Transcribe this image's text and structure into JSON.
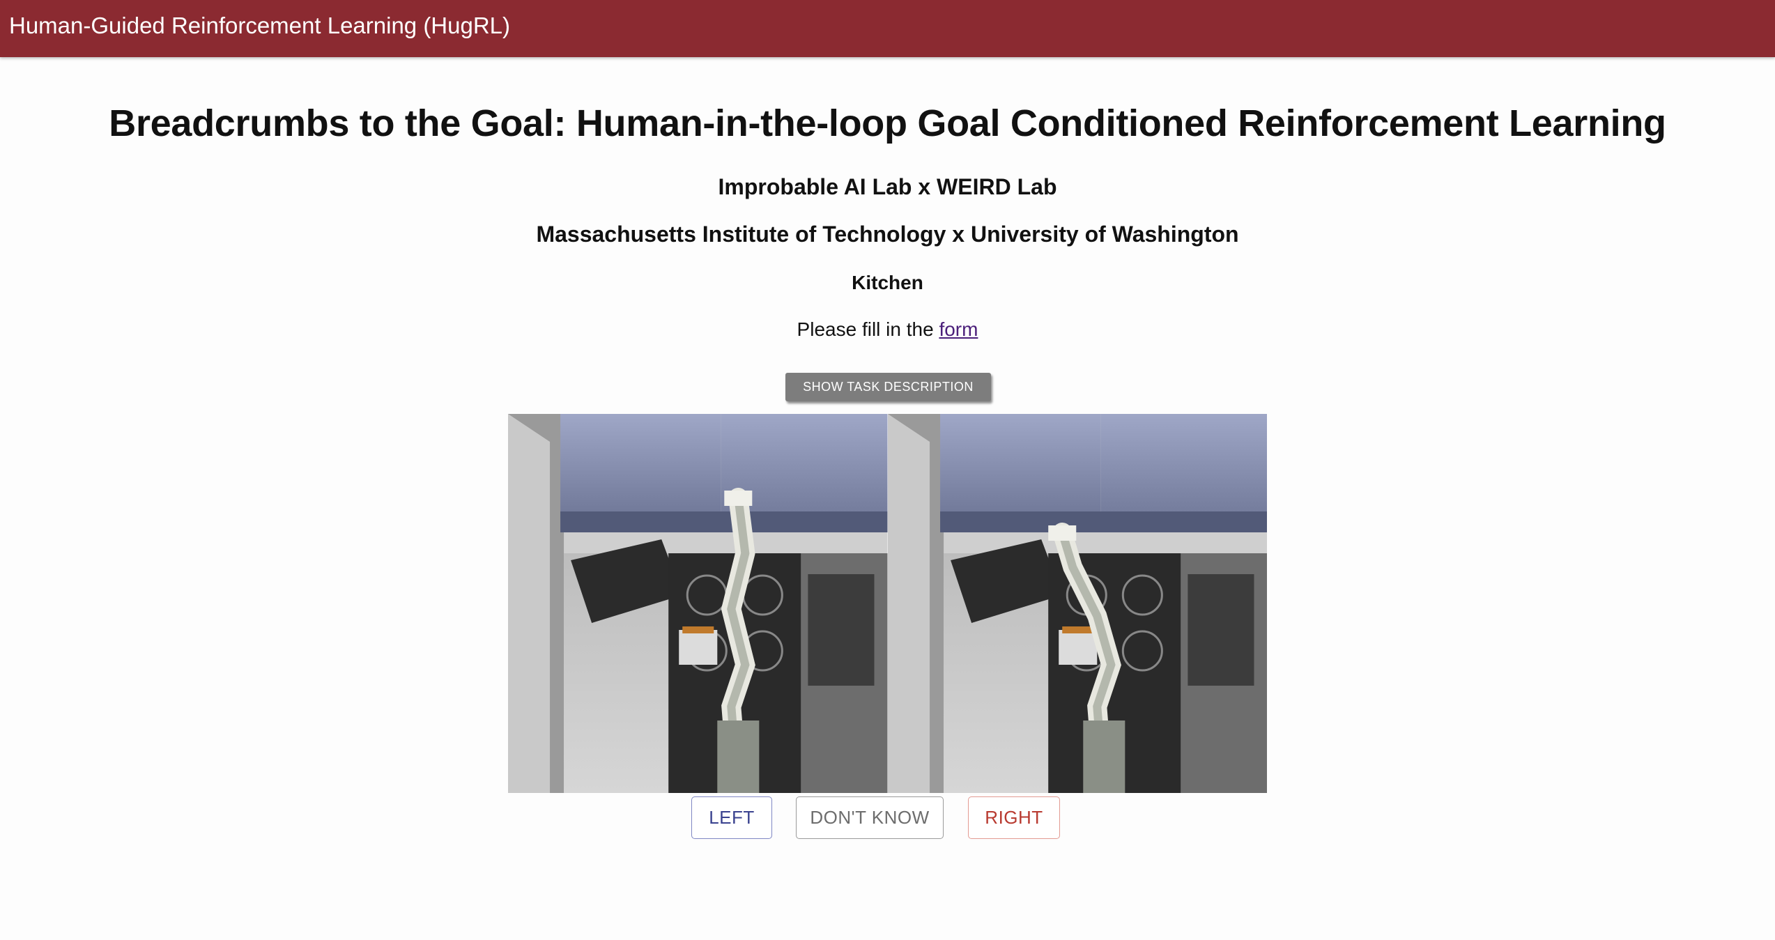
{
  "appbar": {
    "title": "Human-Guided Reinforcement Learning (HugRL)",
    "color": "#8b2a31"
  },
  "header": {
    "title": "Breadcrumbs to the Goal: Human-in-the-loop Goal Conditioned Reinforcement Learning",
    "labs": "Improbable AI Lab x WEIRD Lab",
    "institutions": "Massachusetts Institute of Technology x University of Washington",
    "environment": "Kitchen"
  },
  "form_prompt": {
    "prefix": "Please fill in the ",
    "link_text": "form"
  },
  "task_button": {
    "label": "SHOW TASK DESCRIPTION"
  },
  "frames": [
    {
      "name": "left-frame",
      "scene": "kitchen-robot-arm"
    },
    {
      "name": "right-frame",
      "scene": "kitchen-robot-arm"
    }
  ],
  "choices": {
    "left": "LEFT",
    "dont_know": "DON'T KNOW",
    "right": "RIGHT"
  }
}
